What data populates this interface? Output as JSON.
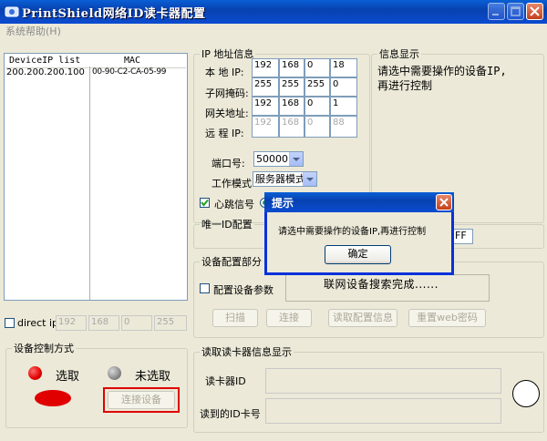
{
  "window": {
    "title": "PrintShield网络ID读卡器配置"
  },
  "menu": {
    "system_help": "系统帮助(H)"
  },
  "device_list": {
    "col_ip": "DeviceIP list",
    "col_mac": "MAC",
    "rows": [
      {
        "ip": "200.200.200.100",
        "mac": "00-90-C2-CA-05-99"
      }
    ]
  },
  "direct_ip": {
    "label": "direct ip",
    "octets": [
      "192",
      "168",
      "0",
      "255"
    ]
  },
  "control_mode": {
    "title": "设备控制方式",
    "selected_label": "选取",
    "unselected_label": "未选取",
    "connect_button": "连接设备",
    "selected_color": "#e00000",
    "unselected_color": "#808080"
  },
  "ip_info": {
    "title": "IP 地址信息",
    "local_ip_label": "本 地 IP:",
    "local_ip": [
      "192",
      "168",
      "0",
      "18"
    ],
    "subnet_label": "子网掩码:",
    "subnet": [
      "255",
      "255",
      "255",
      "0"
    ],
    "gateway_label": "网关地址:",
    "gateway": [
      "192",
      "168",
      "0",
      "1"
    ],
    "remote_ip_label": "远 程 IP:",
    "remote_ip": [
      "192",
      "168",
      "0",
      "88"
    ],
    "port_label": "端口号:",
    "port_value": "50000",
    "mode_label": "工作模式",
    "mode_value": "服务器模式",
    "heartbeat_label": "心跳信号",
    "heartbeat_checked": true
  },
  "info_display": {
    "title": "信息显示",
    "message": "请选中需要操作的设备IP,再进行控制"
  },
  "unique_id": {
    "title": "唯一ID配置",
    "partial_value": "FF"
  },
  "device_config": {
    "title": "设备配置部分",
    "config_params_label": "配置设备参数",
    "status_text": "联网设备搜索完成......",
    "scan_button": "扫描",
    "connect_button": "连接",
    "read_config_button": "读取配置信息",
    "reset_web_button": "重置web密码"
  },
  "reader_info": {
    "title": "读取读卡器信息显示",
    "reader_id_label": "读卡器ID",
    "card_id_label": "读到的ID卡号"
  },
  "dialog": {
    "title": "提示",
    "message": "请选中需要操作的设备IP,再进行控制",
    "ok_button": "确定"
  }
}
